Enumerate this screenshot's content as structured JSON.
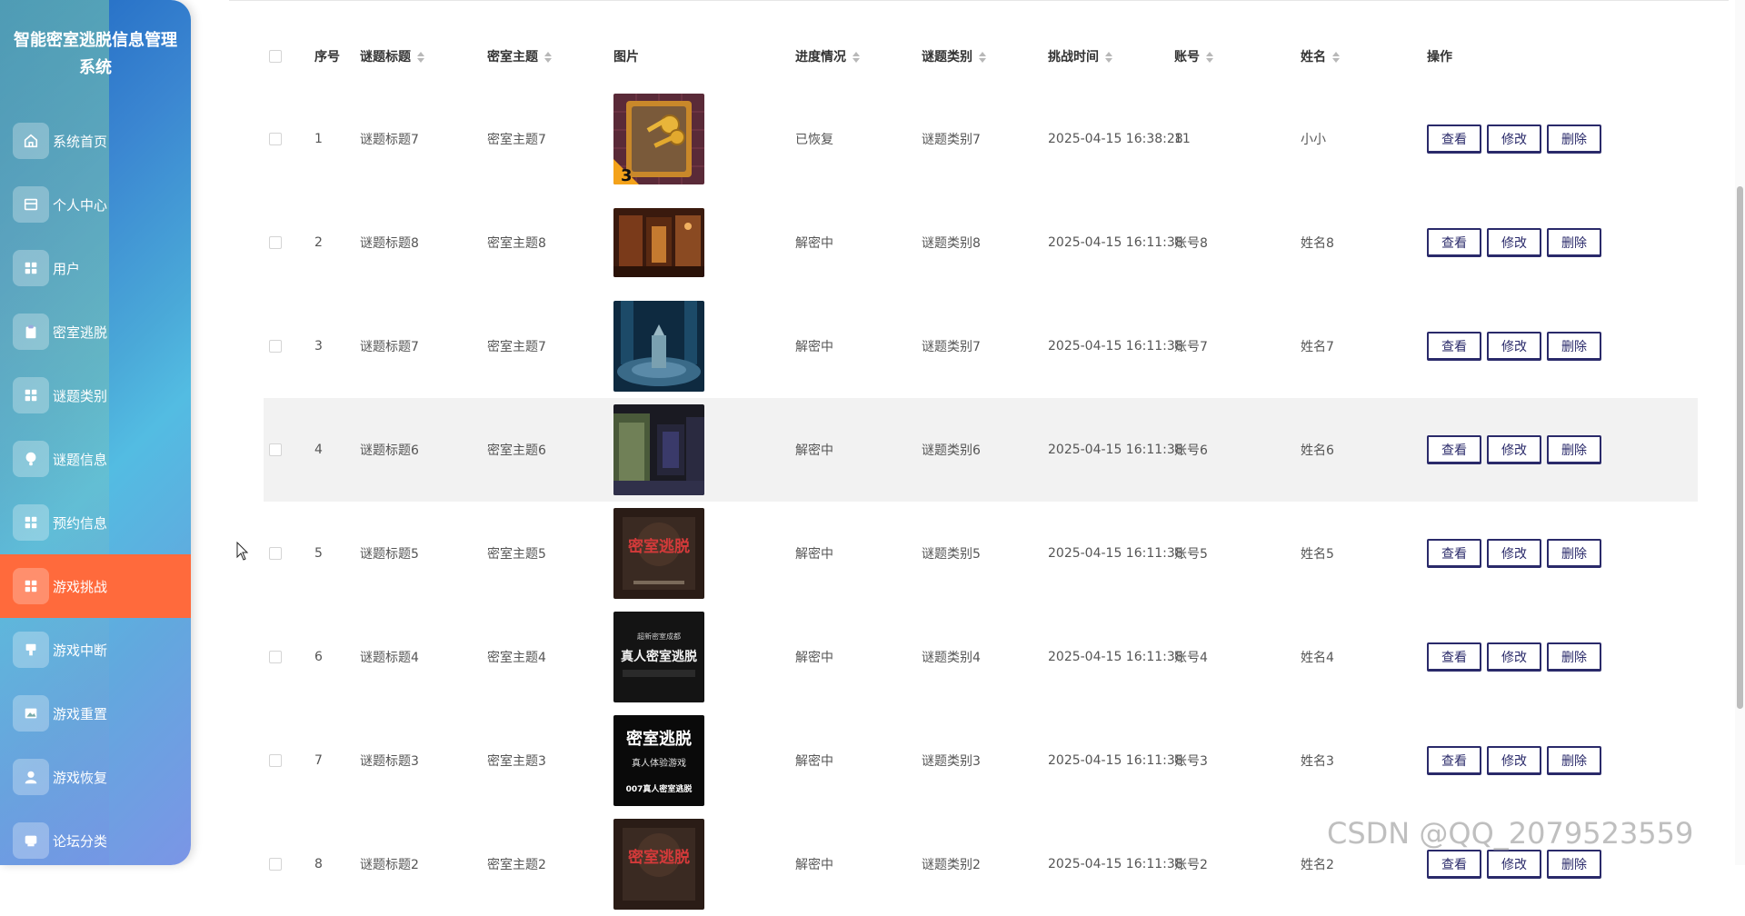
{
  "app": {
    "title_line1": "智能密室逃脱信息管理",
    "title_line2": "系统"
  },
  "sidebar": {
    "items": [
      {
        "label": "系统首页",
        "icon": "home-icon"
      },
      {
        "label": "个人中心",
        "icon": "card-icon"
      },
      {
        "label": "用户",
        "icon": "grid-icon"
      },
      {
        "label": "密室逃脱",
        "icon": "clipboard-icon"
      },
      {
        "label": "谜题类别",
        "icon": "grid-icon"
      },
      {
        "label": "谜题信息",
        "icon": "bulb-icon"
      },
      {
        "label": "预约信息",
        "icon": "grid-icon"
      },
      {
        "label": "游戏挑战",
        "icon": "grid-icon",
        "active": true
      },
      {
        "label": "游戏中断",
        "icon": "tag-icon"
      },
      {
        "label": "游戏重置",
        "icon": "image-icon"
      },
      {
        "label": "游戏恢复",
        "icon": "user-icon"
      },
      {
        "label": "论坛分类",
        "icon": "chat-icon"
      }
    ],
    "active_color": "#ff6a3c"
  },
  "table": {
    "headers": {
      "no": "序号",
      "title": "谜题标题",
      "room": "密室主题",
      "image": "图片",
      "progress": "进度情况",
      "category": "谜题类别",
      "time": "挑战时间",
      "account": "账号",
      "name": "姓名",
      "ops": "操作"
    },
    "actions": {
      "view": "查看",
      "edit": "修改",
      "delete": "删除"
    },
    "rows": [
      {
        "no": "1",
        "title": "谜题标题7",
        "room": "密室主题7",
        "progress": "已恢复",
        "category": "谜题类别7",
        "time": "2025-04-15 16:38:28",
        "account": "11",
        "name": "小小"
      },
      {
        "no": "2",
        "title": "谜题标题8",
        "room": "密室主题8",
        "progress": "解密中",
        "category": "谜题类别8",
        "time": "2025-04-15 16:11:38",
        "account": "账号8",
        "name": "姓名8"
      },
      {
        "no": "3",
        "title": "谜题标题7",
        "room": "密室主题7",
        "progress": "解密中",
        "category": "谜题类别7",
        "time": "2025-04-15 16:11:38",
        "account": "账号7",
        "name": "姓名7"
      },
      {
        "no": "4",
        "title": "谜题标题6",
        "room": "密室主题6",
        "progress": "解密中",
        "category": "谜题类别6",
        "time": "2025-04-15 16:11:38",
        "account": "账号6",
        "name": "姓名6"
      },
      {
        "no": "5",
        "title": "谜题标题5",
        "room": "密室主题5",
        "progress": "解密中",
        "category": "谜题类别5",
        "time": "2025-04-15 16:11:38",
        "account": "账号5",
        "name": "姓名5"
      },
      {
        "no": "6",
        "title": "谜题标题4",
        "room": "密室主题4",
        "progress": "解密中",
        "category": "谜题类别4",
        "time": "2025-04-15 16:11:38",
        "account": "账号4",
        "name": "姓名4"
      },
      {
        "no": "7",
        "title": "谜题标题3",
        "room": "密室主题3",
        "progress": "解密中",
        "category": "谜题类别3",
        "time": "2025-04-15 16:11:38",
        "account": "账号3",
        "name": "姓名3"
      },
      {
        "no": "8",
        "title": "谜题标题2",
        "room": "密室主题2",
        "progress": "解密中",
        "category": "谜题类别2",
        "time": "2025-04-15 16:11:38",
        "account": "账号2",
        "name": "姓名2"
      }
    ]
  },
  "images": {
    "t1": {
      "badge": "3"
    },
    "t5": {
      "text": "密室逃脱"
    },
    "t6": {
      "line1": "超新密室成都",
      "line2": "真人密室逃脱"
    },
    "t7": {
      "line1": "密室逃脱",
      "line2": "真人体验游戏",
      "line3": "007真人密室逃脱"
    },
    "t8": {
      "text": "密室逃脱"
    }
  },
  "watermark": "CSDN @QQ_2079523559"
}
